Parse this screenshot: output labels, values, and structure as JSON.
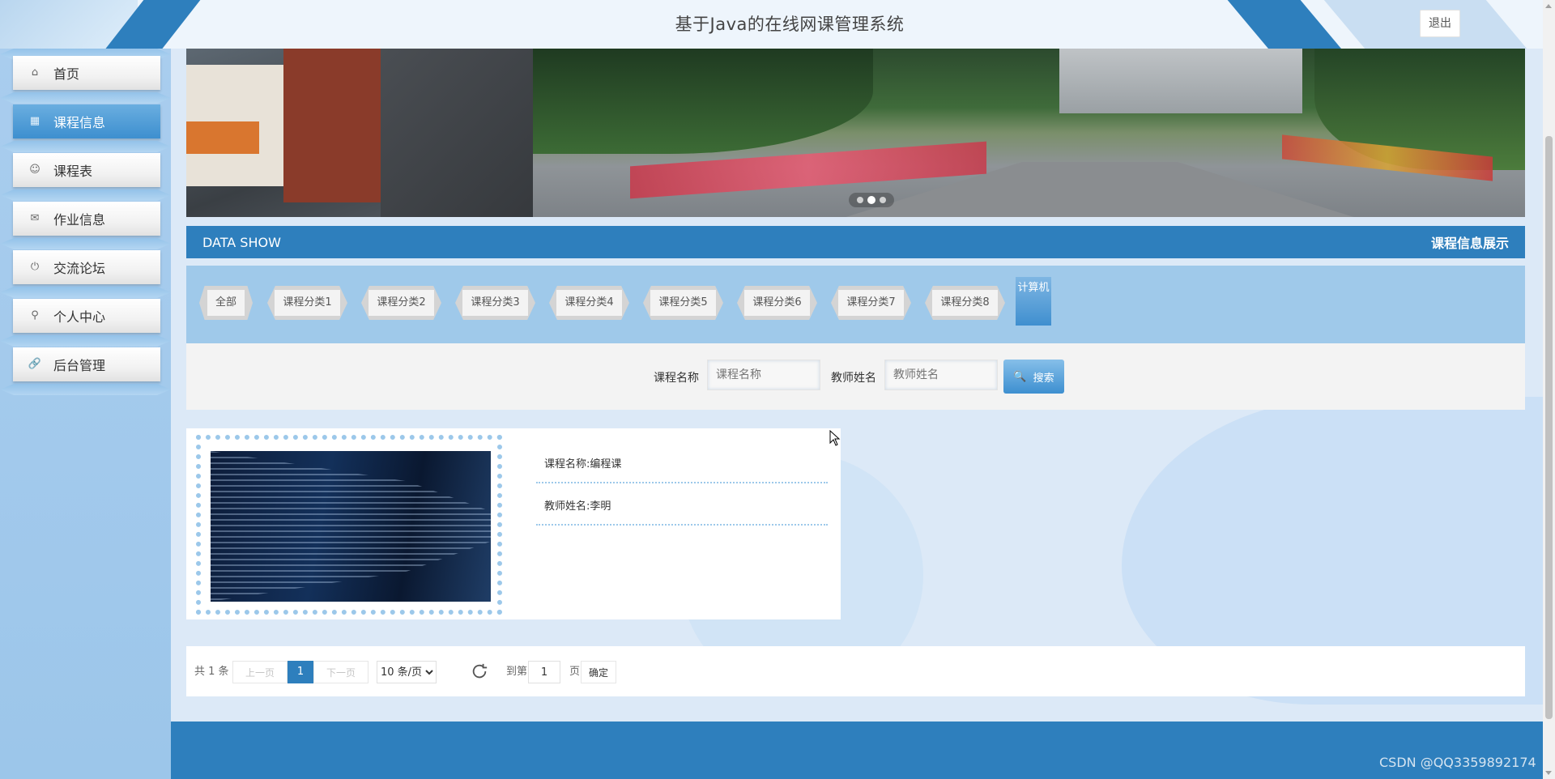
{
  "header": {
    "title": "基于Java的在线网课管理系统",
    "logout_label": "退出"
  },
  "sidebar": {
    "items": [
      {
        "label": "首页",
        "icon": "home-icon"
      },
      {
        "label": "课程信息",
        "icon": "calendar-icon",
        "active": true
      },
      {
        "label": "课程表",
        "icon": "smile-icon"
      },
      {
        "label": "作业信息",
        "icon": "mail-icon"
      },
      {
        "label": "交流论坛",
        "icon": "power-icon"
      },
      {
        "label": "个人中心",
        "icon": "user-icon"
      },
      {
        "label": "后台管理",
        "icon": "link-icon"
      }
    ]
  },
  "banner": {
    "active_slide": 2,
    "slide_count": 3
  },
  "data_show": {
    "left": "DATA SHOW",
    "right": "课程信息展示"
  },
  "categories": [
    "全部",
    "课程分类1",
    "课程分类2",
    "课程分类3",
    "课程分类4",
    "课程分类5",
    "课程分类6",
    "课程分类7",
    "课程分类8",
    "计算机"
  ],
  "selected_category": "计算机",
  "search": {
    "course_label": "课程名称",
    "course_placeholder": "课程名称",
    "teacher_label": "教师姓名",
    "teacher_placeholder": "教师姓名",
    "button_label": "搜索"
  },
  "course": {
    "name_line": "课程名称:编程课",
    "teacher_line": "教师姓名:李明"
  },
  "pager": {
    "total": "共 1 条",
    "prev": "上一页",
    "current": "1",
    "next": "下一页",
    "page_size": "10 条/页",
    "goto_label": "到第",
    "goto_value": "1",
    "page_unit": "页",
    "confirm": "确定"
  },
  "watermark": "CSDN @QQ3359892174",
  "colors": {
    "primary": "#2e7fbd",
    "light": "#9fc9ea",
    "sidebar": "#a9cdee"
  }
}
